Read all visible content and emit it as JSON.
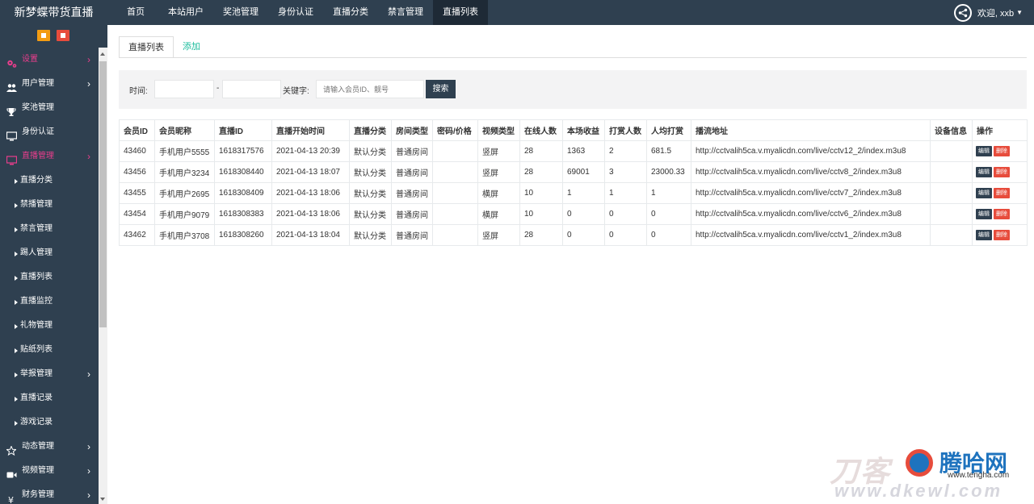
{
  "app": {
    "title": "新梦蝶带货直播"
  },
  "topnav": {
    "items": [
      "首页",
      "本站用户",
      "奖池管理",
      "身份认证",
      "直播分类",
      "禁言管理",
      "直播列表"
    ],
    "active_index": 6
  },
  "user": {
    "greeting": "欢迎, xxb"
  },
  "sidebar": {
    "items": [
      {
        "label": "设置",
        "icon": "gears-icon",
        "arrow": true,
        "color": "#e83e8c"
      },
      {
        "label": "用户管理",
        "icon": "users-icon",
        "arrow": true
      },
      {
        "label": "奖池管理",
        "icon": "trophy-icon",
        "arrow": false
      },
      {
        "label": "身份认证",
        "icon": "monitor-icon",
        "arrow": false
      },
      {
        "label": "直播管理",
        "icon": "desktop-icon",
        "arrow": true,
        "color": "#e83e8c"
      },
      {
        "label": "直播分类",
        "sub": true
      },
      {
        "label": "禁播管理",
        "sub": true
      },
      {
        "label": "禁言管理",
        "sub": true
      },
      {
        "label": "踢人管理",
        "sub": true
      },
      {
        "label": "直播列表",
        "sub": true
      },
      {
        "label": "直播监控",
        "sub": true
      },
      {
        "label": "礼物管理",
        "sub": true
      },
      {
        "label": "贴纸列表",
        "sub": true
      },
      {
        "label": "举报管理",
        "sub": true,
        "arrow": true
      },
      {
        "label": "直播记录",
        "sub": true
      },
      {
        "label": "游戏记录",
        "sub": true
      },
      {
        "label": "动态管理",
        "icon": "star-icon",
        "arrow": true
      },
      {
        "label": "视频管理",
        "icon": "video-icon",
        "arrow": true
      },
      {
        "label": "财务管理",
        "icon": "yen-icon",
        "arrow": true
      }
    ]
  },
  "tabs": {
    "list_label": "直播列表",
    "add_label": "添加"
  },
  "filter": {
    "time_label": "时间:",
    "dash": "-",
    "keyword_label": "关键字:",
    "keyword_placeholder": "请输入会员ID、靓号",
    "search_label": "搜索"
  },
  "table": {
    "columns": [
      "会员ID",
      "会员昵称",
      "直播ID",
      "直播开始时间",
      "直播分类",
      "房间类型",
      "密码/价格",
      "视频类型",
      "在线人数",
      "本场收益",
      "打赏人数",
      "人均打赏",
      "播流地址",
      "设备信息",
      "操作"
    ],
    "rows": [
      [
        "43460",
        "手机用户5555",
        "1618317576",
        "2021-04-13 20:39",
        "默认分类",
        "普通房间",
        "",
        "竖屏",
        "28",
        "1363",
        "2",
        "681.5",
        "http://cctvalih5ca.v.myalicdn.com/live/cctv12_2/index.m3u8",
        ""
      ],
      [
        "43456",
        "手机用户3234",
        "1618308440",
        "2021-04-13 18:07",
        "默认分类",
        "普通房间",
        "",
        "竖屏",
        "28",
        "69001",
        "3",
        "23000.33",
        "http://cctvalih5ca.v.myalicdn.com/live/cctv8_2/index.m3u8",
        ""
      ],
      [
        "43455",
        "手机用户2695",
        "1618308409",
        "2021-04-13 18:06",
        "默认分类",
        "普通房间",
        "",
        "横屏",
        "10",
        "1",
        "1",
        "1",
        "http://cctvalih5ca.v.myalicdn.com/live/cctv7_2/index.m3u8",
        ""
      ],
      [
        "43454",
        "手机用户9079",
        "1618308383",
        "2021-04-13 18:06",
        "默认分类",
        "普通房间",
        "",
        "横屏",
        "10",
        "0",
        "0",
        "0",
        "http://cctvalih5ca.v.myalicdn.com/live/cctv6_2/index.m3u8",
        ""
      ],
      [
        "43462",
        "手机用户3708",
        "1618308260",
        "2021-04-13 18:04",
        "默认分类",
        "普通房间",
        "",
        "竖屏",
        "28",
        "0",
        "0",
        "0",
        "http://cctvalih5ca.v.myalicdn.com/live/cctv1_2/index.m3u8",
        ""
      ]
    ],
    "edit_label": "编辑",
    "delete_label": "删除"
  },
  "watermark": {
    "line1": "刀客",
    "line2": "腾哈网",
    "line3": "www.tengha.com",
    "line4": "www.dkewl.com"
  },
  "colors": {
    "topbar": "#2f4050",
    "accent_pink": "#e83e8c",
    "link": "#1abc9c",
    "danger": "#e74c3c",
    "home_btn": "#f39c12"
  }
}
